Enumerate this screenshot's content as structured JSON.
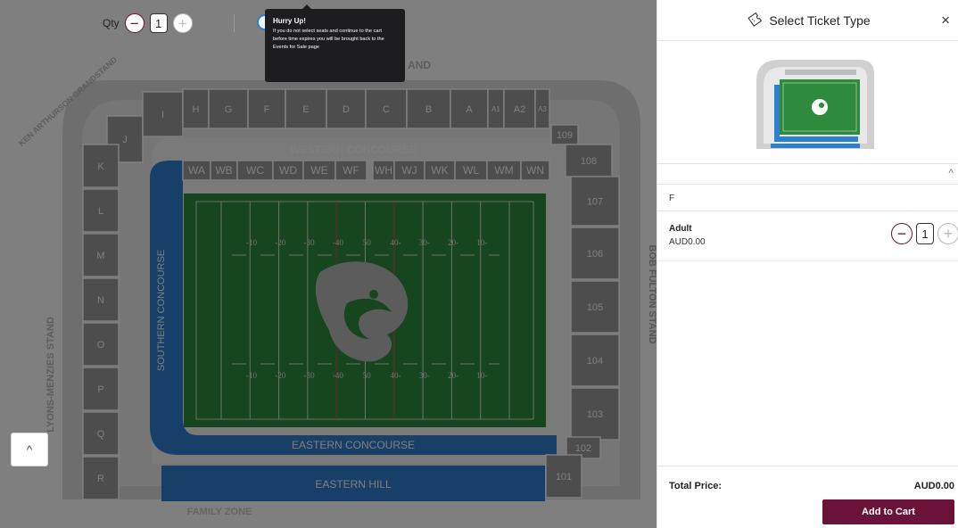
{
  "qty": {
    "label": "Qty",
    "value": "1",
    "minus": "−",
    "plus": "+"
  },
  "tooltip": {
    "title": "Hurry Up!",
    "body": "If you do not select seats and continue to the cart before time expires you will be brought back to the Events for Sale page"
  },
  "map": {
    "stands": {
      "north_partial": "AND",
      "north_west": "KEN ARTHURSON GRANDSTAND",
      "west": "LYONS-MENZIES STAND",
      "east": "BOB FULTON STAND",
      "family": "FAMILY ZONE"
    },
    "concourses": {
      "western": "WESTERN CONCOURSE",
      "southern": "SOUTHERN CONCOURSE",
      "eastern": "EASTERN CONCOURSE",
      "hill": "EASTERN HILL"
    },
    "sections_top": [
      "J",
      "I",
      "H",
      "G",
      "F",
      "E",
      "D",
      "C",
      "B",
      "A",
      "A1",
      "A2",
      "A3"
    ],
    "sections_left": [
      "K",
      "L",
      "M",
      "N",
      "O",
      "P",
      "Q",
      "R"
    ],
    "sections_right": [
      "109",
      "108",
      "107",
      "106",
      "105",
      "104",
      "103",
      "102",
      "101"
    ],
    "wings": [
      "WA",
      "WB",
      "WC",
      "WD",
      "WE",
      "WF",
      "WH",
      "WJ",
      "WK",
      "WL",
      "WM",
      "WN"
    ],
    "yard_numbers": [
      "-10",
      "-20",
      "-30",
      "-40",
      "50",
      "40-",
      "30-",
      "20-",
      "10-"
    ],
    "collapse_icon": "chevron-up-icon",
    "collapse_glyph": "^"
  },
  "panel": {
    "title": "Select Ticket Type",
    "close": "×",
    "accordion_glyph": "^",
    "section": "F",
    "ticket": {
      "name": "Adult",
      "price": "AUD0.00",
      "qty": "1"
    },
    "total_label": "Total Price:",
    "total_value": "AUD0.00",
    "cta": "Add to Cart"
  },
  "colors": {
    "brand": "#6b1238",
    "field": "#2e8b3c",
    "concourse": "#2f7fd1",
    "seat": "#9a9a9a"
  }
}
